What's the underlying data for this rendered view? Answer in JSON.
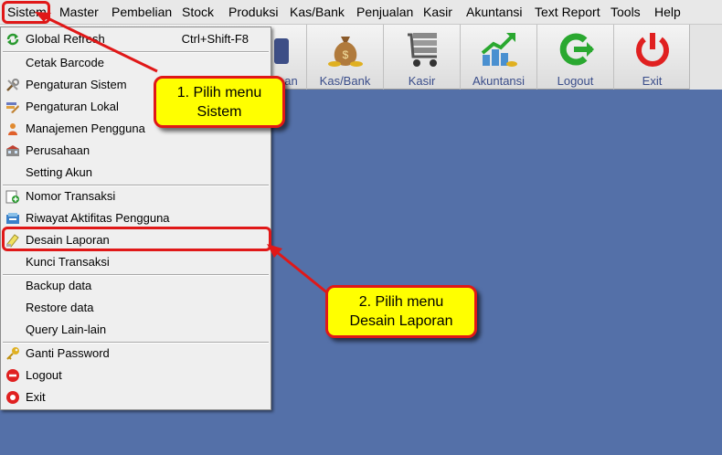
{
  "menubar": {
    "items": [
      "Sistem",
      "Master",
      "Pembelian",
      "Stock",
      "Produksi",
      "Kas/Bank",
      "Penjualan",
      "Kasir",
      "Akuntansi",
      "Text Report",
      "Tools",
      "Help"
    ]
  },
  "toolbar": {
    "partial_label": "an",
    "buttons": [
      {
        "label": "Kas/Bank",
        "icon": "money-bag-icon"
      },
      {
        "label": "Kasir",
        "icon": "cash-cart-icon"
      },
      {
        "label": "Akuntansi",
        "icon": "growth-chart-icon"
      },
      {
        "label": "Logout",
        "icon": "logout-arrow-icon"
      },
      {
        "label": "Exit",
        "icon": "power-icon"
      }
    ]
  },
  "dropdown": {
    "items": [
      {
        "label": "Global Refresh",
        "shortcut": "Ctrl+Shift-F8",
        "icon": "refresh-icon"
      },
      {
        "label": "Cetak Barcode",
        "icon": ""
      },
      {
        "label": "Pengaturan Sistem",
        "icon": "tools-icon"
      },
      {
        "label": "Pengaturan Lokal",
        "icon": "edit-icon"
      },
      {
        "label": "Manajemen Pengguna",
        "icon": "user-icon"
      },
      {
        "label": "Perusahaan",
        "icon": "company-icon"
      },
      {
        "label": "Setting Akun",
        "icon": ""
      },
      {
        "label": "Nomor Transaksi",
        "icon": "add-document-icon"
      },
      {
        "label": "Riwayat Aktifitas Pengguna",
        "icon": "history-icon"
      },
      {
        "label": "Desain Laporan",
        "icon": "report-design-icon"
      },
      {
        "label": "Kunci Transaksi",
        "icon": ""
      },
      {
        "label": "Backup data",
        "icon": ""
      },
      {
        "label": "Restore data",
        "icon": ""
      },
      {
        "label": "Query Lain-lain",
        "icon": ""
      },
      {
        "label": "Ganti Password",
        "icon": "key-icon"
      },
      {
        "label": "Logout",
        "icon": "logout-icon"
      },
      {
        "label": "Exit",
        "icon": "exit-icon"
      }
    ]
  },
  "callouts": {
    "step1": {
      "line1": "1. Pilih menu",
      "line2": "Sistem"
    },
    "step2": {
      "line1": "2. Pilih menu",
      "line2": "Desain Laporan"
    }
  },
  "colors": {
    "desktop": "#5470a8",
    "annotation": "#e01818",
    "callout_bg": "#ffff00",
    "toolbar_label": "#3a4d8a"
  }
}
